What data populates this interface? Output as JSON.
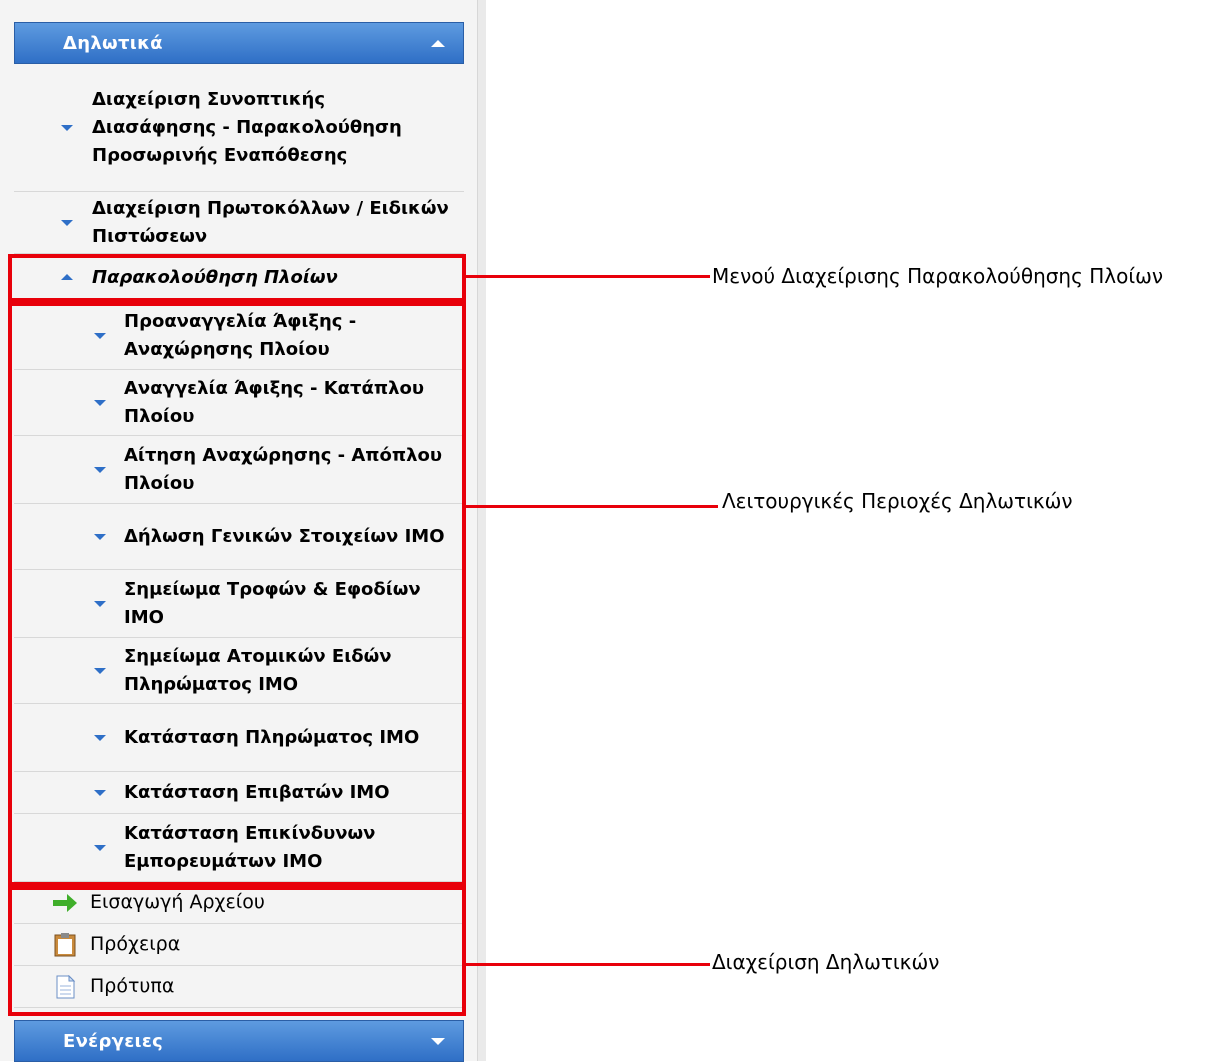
{
  "sections": {
    "declarations_label": "Δηλωτικά",
    "actions_label": "Ενέργειες"
  },
  "menu": {
    "top_items": [
      "Διαχείριση Συνοπτικής Διασάφησης - Παρακολούθηση Προσωρινής Εναπόθεσης",
      "Διαχείριση Πρωτοκόλλων / Ειδικών Πιστώσεων"
    ],
    "ship_tracking_label": "Παρακολούθηση Πλοίων",
    "ship_items": [
      "Προαναγγελία Άφιξης - Αναχώρησης Πλοίου",
      "Αναγγελία Άφιξης - Κατάπλου Πλοίου",
      "Αίτηση Αναχώρησης - Απόπλου Πλοίου",
      "Δήλωση Γενικών Στοιχείων IMO",
      "Σημείωμα Τροφών & Εφοδίων IMO",
      "Σημείωμα Ατομικών Ειδών Πληρώματος IMO",
      "Κατάσταση Πληρώματος IMO",
      "Κατάσταση Επιβατών IMO",
      "Κατάσταση Επικίνδυνων Εμπορευμάτων IMO"
    ],
    "management": [
      {
        "label": "Εισαγωγή Αρχείου",
        "icon": "arrow-right-icon"
      },
      {
        "label": "Πρόχειρα",
        "icon": "clipboard-icon"
      },
      {
        "label": "Πρότυπα",
        "icon": "document-icon"
      }
    ]
  },
  "annotations": {
    "ship_menu": "Μενού Διαχείρισης Παρακολούθησης Πλοίων",
    "functional_areas": "Λειτουργικές Περιοχές Δηλωτικών",
    "management": "Διαχείριση Δηλωτικών"
  },
  "colors": {
    "header_blue": "#2f6fc6",
    "highlight_red": "#e8000a",
    "arrow_green": "#3fae2a"
  }
}
